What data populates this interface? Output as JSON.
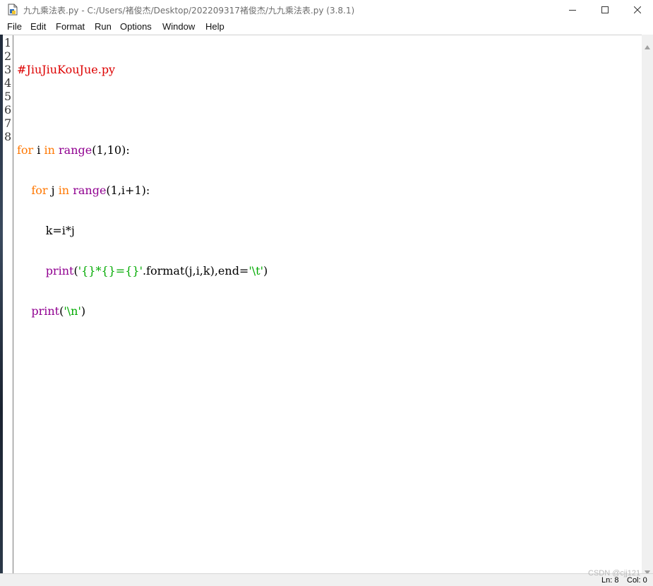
{
  "window": {
    "title": "九九乘法表.py - C:/Users/褚俊杰/Desktop/202209317褚俊杰/九九乘法表.py (3.8.1)",
    "app_icon": "idle-file-icon",
    "controls": [
      "minimize-icon",
      "maximize-icon",
      "close-icon"
    ]
  },
  "menu": {
    "file": "File",
    "edit": "Edit",
    "format": "Format",
    "run": "Run",
    "options": "Options",
    "window": "Window",
    "help": "Help"
  },
  "line_numbers": [
    "1",
    "2",
    "3",
    "4",
    "5",
    "6",
    "7",
    "8"
  ],
  "code": {
    "l1_comment": "#JiuJiuKouJue.py",
    "l3_for": "for",
    "l3_i": " i ",
    "l3_in": "in",
    "l3_sp": " ",
    "l3_range": "range",
    "l3_args": "(1,10):",
    "l4_indent": "    ",
    "l4_for": "for",
    "l4_j": " j ",
    "l4_in": "in",
    "l4_sp": " ",
    "l4_range": "range",
    "l4_args": "(1,i+1):",
    "l5_text": "        k=i*j",
    "l6_indent": "        ",
    "l6_print": "print",
    "l6_open": "(",
    "l6_str": "'{}*{}={}'",
    "l6_mid": ".format(j,i,k),end=",
    "l6_str2": "'\\t'",
    "l6_close": ")",
    "l7_indent": "    ",
    "l7_print": "print",
    "l7_open": "(",
    "l7_str": "'\\n'",
    "l7_close": ")"
  },
  "colors": {
    "keyword": "#ff7700",
    "builtin": "#900090",
    "string": "#00aa00",
    "comment": "#dd0000"
  },
  "status": {
    "ln": "Ln: 8",
    "col": "Col: 0"
  },
  "watermark": "CSDN @cjj121"
}
